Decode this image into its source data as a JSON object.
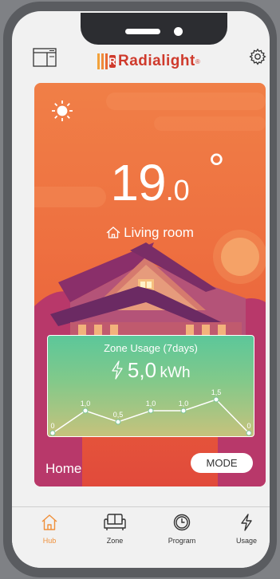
{
  "header": {
    "brand": "Radialight",
    "brand_reg": "®",
    "left_icon": "dashboard-panel-icon",
    "right_icon": "gear-icon"
  },
  "thermostat": {
    "temp_int": "19",
    "temp_dec": ".0",
    "degree": "°",
    "room": "Living room",
    "mode_icon": "sun-icon"
  },
  "usage": {
    "title": "Zone Usage (7days)",
    "value": "5,0",
    "unit": "kWh",
    "icon": "lightning-icon"
  },
  "chart_data": {
    "type": "line",
    "x": [
      1,
      2,
      3,
      4,
      5,
      6,
      7
    ],
    "values": [
      0,
      1.0,
      0.5,
      1.0,
      1.0,
      1.5,
      0
    ],
    "labels": [
      "0",
      "1,0",
      "0,5",
      "1,0",
      "1,0",
      "1,5",
      "0"
    ],
    "title": "Zone Usage (7days)",
    "color": "#ffffff"
  },
  "zone": {
    "name": "Home",
    "mode_label": "MODE"
  },
  "tabs": [
    {
      "label": "Hub",
      "icon": "home-icon",
      "active": true
    },
    {
      "label": "Zone",
      "icon": "sofa-icon",
      "active": false
    },
    {
      "label": "Program",
      "icon": "clock-icon",
      "active": false
    },
    {
      "label": "Usage",
      "icon": "lightning-icon",
      "active": false
    }
  ],
  "colors": {
    "accent": "#f0903a",
    "brand": "#cf3a2c"
  }
}
